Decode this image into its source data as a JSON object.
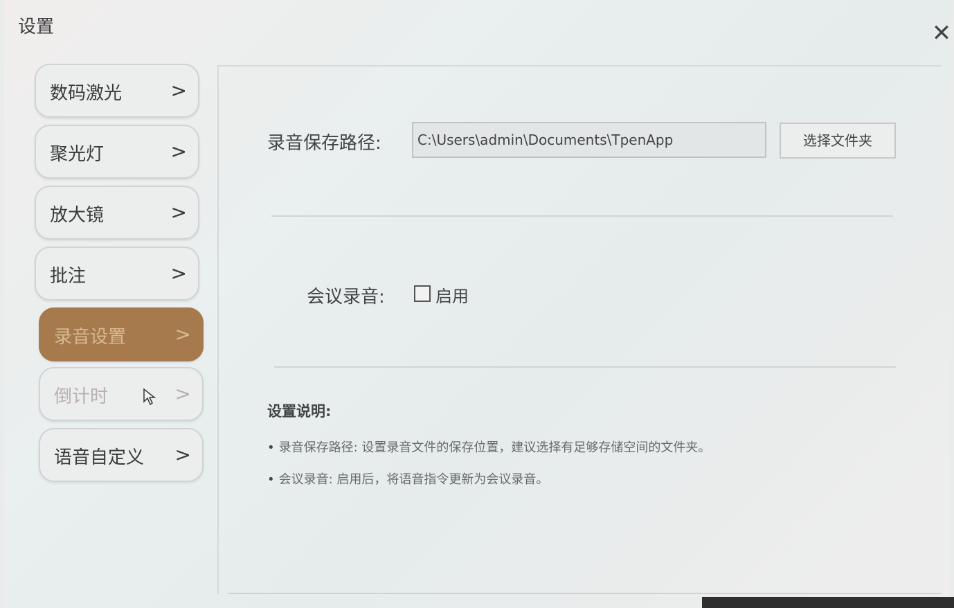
{
  "window": {
    "title": "设置",
    "close_icon": "✕"
  },
  "sidebar": {
    "items": [
      {
        "label": "数码激光",
        "chevron": ">"
      },
      {
        "label": "聚光灯",
        "chevron": ">"
      },
      {
        "label": "放大镜",
        "chevron": ">"
      },
      {
        "label": "批注",
        "chevron": ">"
      },
      {
        "label": "录音设置",
        "chevron": ">",
        "active": true
      },
      {
        "label": "倒计时",
        "chevron": ">"
      },
      {
        "label": "语音自定义",
        "chevron": ">"
      }
    ]
  },
  "recording": {
    "path_label": "录音保存路径:",
    "path_value": "C:\\Users\\admin\\Documents\\TpenApp",
    "choose_folder_label": "选择文件夹",
    "meeting_label": "会议录音:",
    "enable_label": "启用",
    "enable_checked": false
  },
  "notes": {
    "title": "设置说明:",
    "items": [
      "录音保存路径: 设置录音文件的保存位置，建议选择有足够存储空间的文件夹。",
      "会议录音: 启用后，将语音指令更新为会议录音。"
    ]
  },
  "colors": {
    "active_nav_bg": "#a67a4d",
    "active_nav_text": "#d6b991"
  }
}
